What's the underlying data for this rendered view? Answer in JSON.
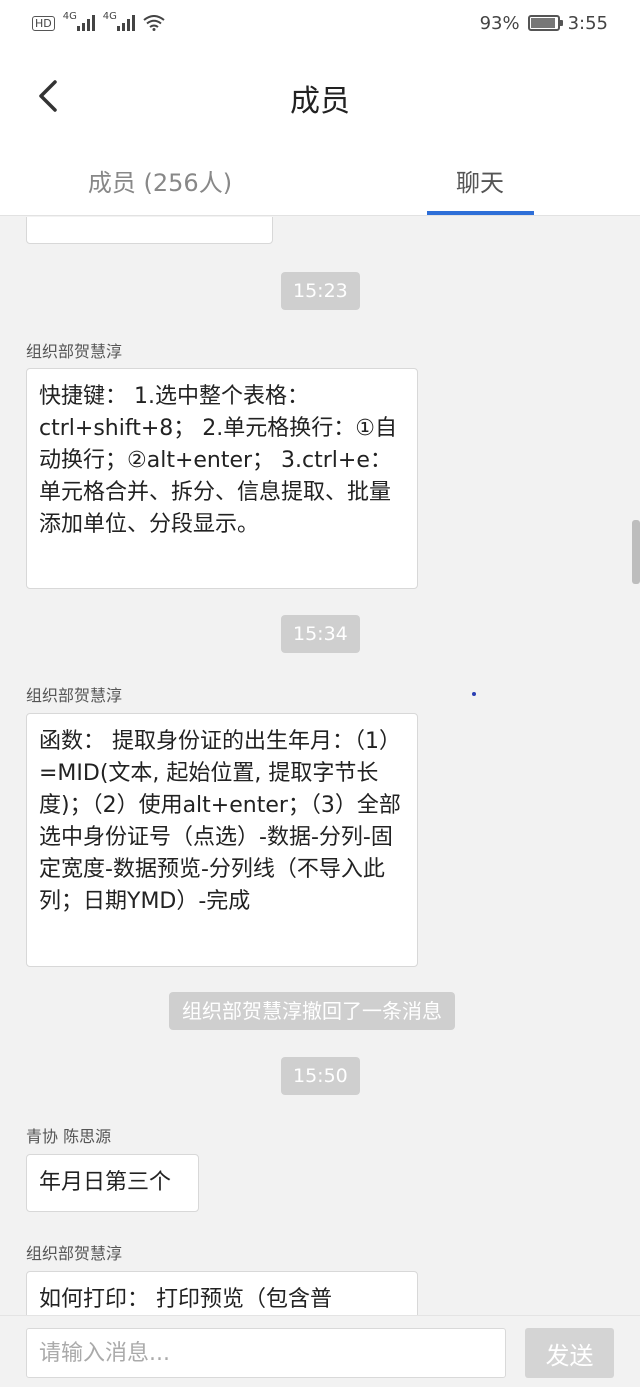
{
  "status_bar": {
    "hd_label": "HD",
    "network_1": "4G",
    "network_2": "4G",
    "battery_percent": "93%",
    "battery_level": 0.93,
    "time": "3:55"
  },
  "header": {
    "title": "成员",
    "back_icon": "chevron-left-icon"
  },
  "tabs": [
    {
      "label": "成员 (256人)",
      "active": false
    },
    {
      "label": "聊天",
      "active": true
    }
  ],
  "chat": {
    "messages": [
      {
        "type": "time",
        "text": "15:23"
      },
      {
        "type": "message",
        "sender": "组织部贺慧淳",
        "text": "快捷键： 1.选中整个表格：ctrl+shift+8； 2.单元格换行：①自动换行；②alt+enter； 3.ctrl+e：单元格合并、拆分、信息提取、批量添加单位、分段显示。"
      },
      {
        "type": "time",
        "text": "15:34"
      },
      {
        "type": "message",
        "sender": "组织部贺慧淳",
        "text": "函数： 提取身份证的出生年月：（1）=MID(文本, 起始位置, 提取字节长度)；（2）使用alt+enter；（3）全部选中身份证号（点选）-数据-分列-固定宽度-数据预览-分列线（不导入此列；日期YMD）-完成"
      },
      {
        "type": "recall",
        "text": "组织部贺慧淳撤回了一条消息"
      },
      {
        "type": "time",
        "text": "15:50"
      },
      {
        "type": "message",
        "sender": "青协 陈思源",
        "text": "年月日第三个"
      },
      {
        "type": "message",
        "sender": "组织部贺慧淳",
        "text": "如何打印： 打印预览（包含普"
      }
    ]
  },
  "input": {
    "placeholder": "请输入消息...",
    "send_label": "发送"
  },
  "colors": {
    "accent": "#2e6fd8",
    "background": "#f2f2f2",
    "chip": "#cfcfcf"
  }
}
